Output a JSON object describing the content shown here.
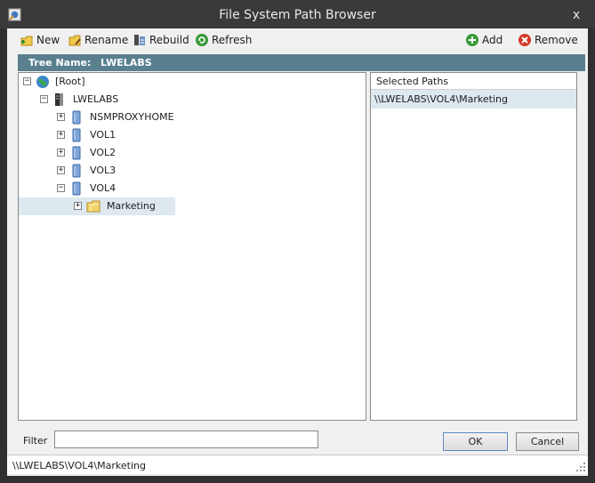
{
  "window": {
    "title": "File System Path Browser",
    "close_glyph": "x"
  },
  "toolbar": {
    "new_label": "New",
    "rename_label": "Rename",
    "rebuild_label": "Rebuild",
    "refresh_label": "Refresh",
    "add_label": "Add",
    "remove_label": "Remove"
  },
  "tree_name": {
    "label": "Tree Name:",
    "value": "LWELABS"
  },
  "tree": {
    "nodes": [
      {
        "label": "[Root]",
        "icon": "globe-icon",
        "expander": "−"
      },
      {
        "label": "LWELABS",
        "icon": "server-icon",
        "expander": "−"
      },
      {
        "label": "NSMPROXYHOME",
        "icon": "volume-icon",
        "expander": "+"
      },
      {
        "label": "VOL1",
        "icon": "volume-icon",
        "expander": "+"
      },
      {
        "label": "VOL2",
        "icon": "volume-icon",
        "expander": "+"
      },
      {
        "label": "VOL3",
        "icon": "volume-icon",
        "expander": "+"
      },
      {
        "label": "VOL4",
        "icon": "volume-icon",
        "expander": "−"
      },
      {
        "label": "Marketing",
        "icon": "folder-icon",
        "expander": "+",
        "selected": true
      }
    ]
  },
  "selected_paths": {
    "header": "Selected Paths",
    "rows": [
      "\\\\LWELABS\\VOL4\\Marketing"
    ]
  },
  "filter": {
    "label": "Filter",
    "value": ""
  },
  "buttons": {
    "ok": "OK",
    "cancel": "Cancel"
  },
  "status": {
    "path": "\\\\LWELABS\\VOL4\\Marketing"
  },
  "colors": {
    "namebar": "#5a8090",
    "selection": "#dde8ef"
  }
}
